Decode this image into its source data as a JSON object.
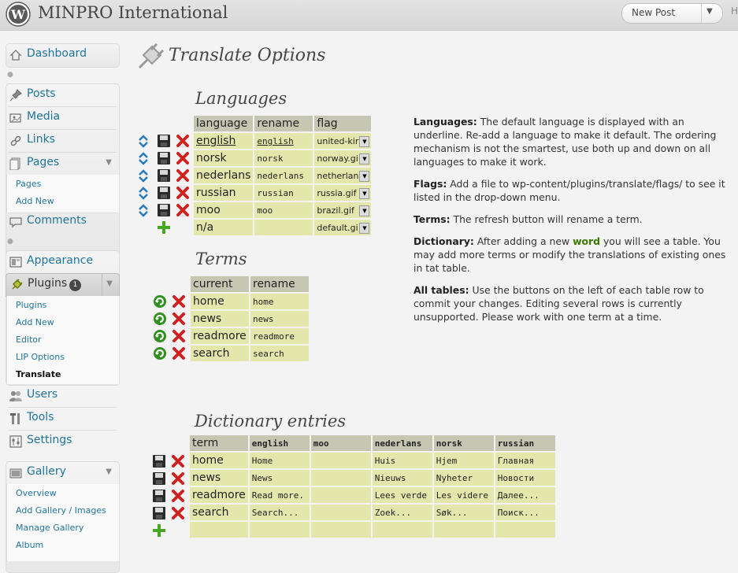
{
  "header": {
    "site_title": "MINPRO International",
    "new_post_label": "New Post",
    "overflow_char": "H"
  },
  "sidebar": {
    "top_items": [
      {
        "label": "Dashboard",
        "icon": "dashboard-icon"
      }
    ],
    "content_items": [
      {
        "label": "Posts",
        "icon": "pin-icon"
      },
      {
        "label": "Media",
        "icon": "media-icon"
      },
      {
        "label": "Links",
        "icon": "links-icon"
      },
      {
        "label": "Pages",
        "icon": "pages-icon"
      }
    ],
    "pages_sub": [
      "Pages",
      "Add New"
    ],
    "comments_label": "Comments",
    "appearance_label": "Appearance",
    "plugins_label": "Plugins",
    "plugins_badge": "1",
    "plugins_sub": [
      "Plugins",
      "Add New",
      "Editor",
      "LIP Options",
      "Translate"
    ],
    "users_label": "Users",
    "tools_label": "Tools",
    "settings_label": "Settings",
    "gallery_label": "Gallery",
    "gallery_sub": [
      "Overview",
      "Add Gallery / Images",
      "Manage Gallery",
      "Album"
    ]
  },
  "main": {
    "page_title": "Translate Options",
    "languages": {
      "title": "Languages",
      "headers": [
        "language",
        "rename",
        "flag"
      ],
      "rows": [
        {
          "language": "english",
          "rename": "english",
          "flag": "united-kir",
          "is_default": true
        },
        {
          "language": "norsk",
          "rename": "norsk",
          "flag": "norway.gi"
        },
        {
          "language": "nederlans",
          "rename": "nederlans",
          "flag": "netherlan"
        },
        {
          "language": "russian",
          "rename": "russian",
          "flag": "russia.gif"
        },
        {
          "language": "moo",
          "rename": "moo",
          "flag": "brazil.gif"
        }
      ],
      "new_row": {
        "language": "n/a",
        "rename": "",
        "flag": "default.gi"
      }
    },
    "terms": {
      "title": "Terms",
      "headers": [
        "current",
        "rename"
      ],
      "rows": [
        {
          "current": "home",
          "rename": "home"
        },
        {
          "current": "news",
          "rename": "news"
        },
        {
          "current": "readmore",
          "rename": "readmore"
        },
        {
          "current": "search",
          "rename": "search"
        }
      ]
    },
    "dictionary": {
      "title": "Dictionary entries",
      "headers": [
        "term",
        "english",
        "moo",
        "nederlans",
        "norsk",
        "russian"
      ],
      "rows": [
        [
          "home",
          "Home",
          "",
          "Huis",
          "Hjem",
          "Главная"
        ],
        [
          "news",
          "News",
          "",
          "Nieuws",
          "Nyheter",
          "Новости"
        ],
        [
          "readmore",
          "Read more.",
          "",
          "Lees verde",
          "Les videre",
          "Далее..."
        ],
        [
          "search",
          "Search...",
          "",
          "Zoek...",
          "Søk...",
          "Поиск..."
        ]
      ]
    }
  },
  "help": {
    "languages_label": "Languages:",
    "languages_text": "The default language is displayed with an underline. Re-add a language to make it default. The ordering mechanism is not the smartest, use both up and down on all languages to make it work.",
    "flags_label": "Flags:",
    "flags_text": "Add a file to wp-content/plugins/translate/flags/ to see it listed in the drop-down menu.",
    "terms_label": "Terms:",
    "terms_text": "The refresh button will rename a term.",
    "dictionary_label": "Dictionary:",
    "dictionary_pre": "After adding a new",
    "dictionary_word": "word",
    "dictionary_post": "you will see a table. You may add more terms or modify the translations of existing ones in tat table.",
    "all_label": "All tables:",
    "all_text": "Use the buttons on the left of each table row to commit your changes. Editing several rows is currently unsupported. Please work with one term at a time."
  },
  "colors": {
    "link": "#21759b",
    "cell_bg": "#e4e7ab",
    "header_bg": "#c6c7b3",
    "delete_red": "#cc2222",
    "refresh_green": "#2f8f1f"
  }
}
